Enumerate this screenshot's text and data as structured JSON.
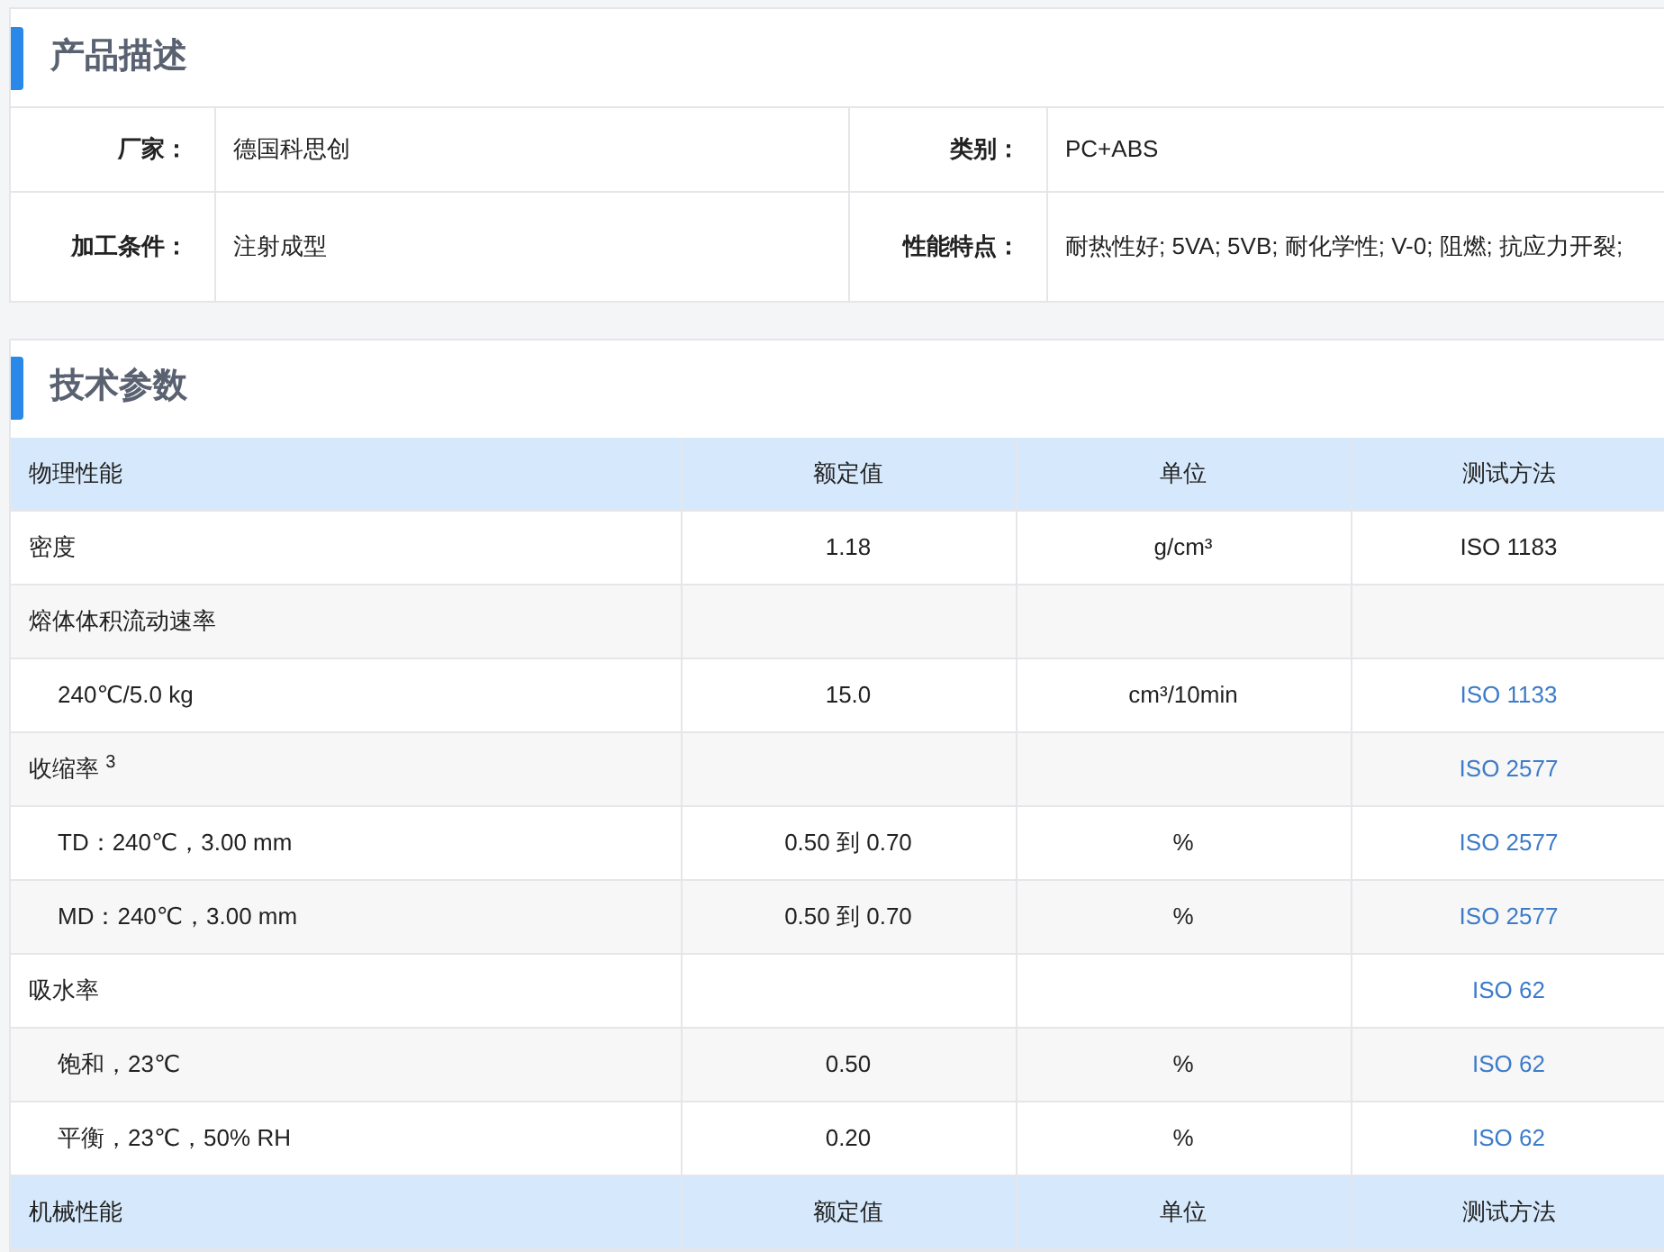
{
  "description": {
    "title": "产品描述",
    "rows": [
      [
        {
          "label": "厂家：",
          "value": "德国科思创"
        },
        {
          "label": "类别：",
          "value": "PC+ABS"
        }
      ],
      [
        {
          "label": "加工条件：",
          "value": "注射成型"
        },
        {
          "label": "性能特点：",
          "value": "耐热性好; 5VA; 5VB; 耐化学性; V-0; 阻燃; 抗应力开裂;"
        }
      ]
    ]
  },
  "parameters": {
    "title": "技术参数",
    "sections": [
      {
        "columns": [
          "物理性能",
          "额定值",
          "单位",
          "测试方法"
        ],
        "rows": [
          {
            "name": "密度",
            "value": "1.18",
            "unit": "g/cm³",
            "method": "ISO 1183",
            "method_link": false
          },
          {
            "name": "熔体体积流动速率",
            "children": [
              {
                "name": "240℃/5.0 kg",
                "value": "15.0",
                "unit": "cm³/10min",
                "method": "ISO 1133",
                "method_link": true
              }
            ]
          },
          {
            "name": "收缩率 $^{3}$",
            "method": "ISO 2577",
            "method_link": true,
            "children": [
              {
                "name": "TD：240℃，3.00 mm",
                "value": "0.50 到 0.70",
                "unit": "%",
                "method": "ISO 2577",
                "method_link": true
              },
              {
                "name": "MD：240℃，3.00 mm",
                "value": "0.50 到 0.70",
                "unit": "%",
                "method": "ISO 2577",
                "method_link": true
              }
            ]
          },
          {
            "name": "吸水率",
            "method": "ISO 62",
            "method_link": true,
            "children": [
              {
                "name": "饱和，23℃",
                "value": "0.50",
                "unit": "%",
                "method": "ISO 62",
                "method_link": true
              },
              {
                "name": "平衡，23℃，50% RH",
                "value": "0.20",
                "unit": "%",
                "method": "ISO 62",
                "method_link": true
              }
            ]
          }
        ]
      },
      {
        "columns": [
          "机械性能",
          "额定值",
          "单位",
          "测试方法"
        ]
      }
    ]
  }
}
